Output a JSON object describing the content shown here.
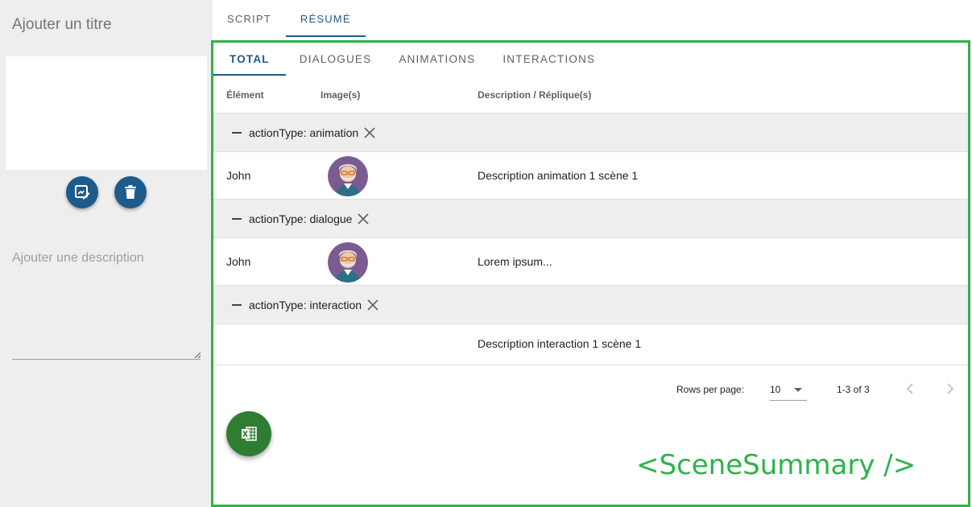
{
  "left_panel": {
    "title_placeholder": "Ajouter un titre",
    "description_placeholder": "Ajouter une description"
  },
  "top_tabs": [
    {
      "label": "SCRIPT",
      "active": false
    },
    {
      "label": "RÉSUMÉ",
      "active": true
    }
  ],
  "sub_tabs": [
    {
      "label": "TOTAL",
      "active": true
    },
    {
      "label": "DIALOGUES",
      "active": false
    },
    {
      "label": "ANIMATIONS",
      "active": false
    },
    {
      "label": "INTERACTIONS",
      "active": false
    }
  ],
  "table": {
    "columns": [
      "Élément",
      "Image(s)",
      "Description / Réplique(s)"
    ],
    "groups": [
      {
        "label": "actionType: animation",
        "rows": [
          {
            "element": "John",
            "has_image": true,
            "description": "Description animation 1 scène 1"
          }
        ]
      },
      {
        "label": "actionType: dialogue",
        "rows": [
          {
            "element": "John",
            "has_image": true,
            "description": "Lorem ipsum..."
          }
        ]
      },
      {
        "label": "actionType: interaction",
        "rows": [
          {
            "element": "",
            "has_image": false,
            "description": "Description interaction 1 scène 1"
          }
        ]
      }
    ]
  },
  "pagination": {
    "rows_per_page_label": "Rows per page:",
    "rows_per_page_value": "10",
    "range": "1-3 of 3"
  },
  "icons": {
    "edit_button": "edit-image-icon",
    "delete_button": "trash-icon",
    "export_fab": "excel-icon",
    "group_collapse": "minus-icon",
    "group_remove": "close-icon",
    "prev_page": "chevron-left-icon",
    "next_page": "chevron-right-icon"
  },
  "colors": {
    "primary": "#1e5a8a",
    "export_green": "#2e7d32",
    "annotation_green": "#2db34a"
  },
  "overlay_label": "<SceneSummary />"
}
